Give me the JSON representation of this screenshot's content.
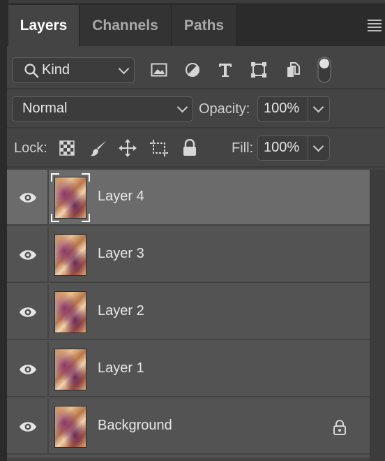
{
  "tabs": [
    {
      "label": "Layers",
      "active": true
    },
    {
      "label": "Channels",
      "active": false
    },
    {
      "label": "Paths",
      "active": false
    }
  ],
  "filter": {
    "kind_label": "Kind",
    "icons": [
      "image-filter-icon",
      "adjustment-filter-icon",
      "type-filter-icon",
      "shape-filter-icon",
      "smart-object-filter-icon",
      "filter-toggle-icon"
    ]
  },
  "blend": {
    "mode": "Normal",
    "opacity_label": "Opacity:",
    "opacity_value": "100%"
  },
  "lock_row": {
    "lock_label": "Lock:",
    "fill_label": "Fill:",
    "fill_value": "100%",
    "icons": [
      "lock-transparent-pixels-icon",
      "lock-image-pixels-icon",
      "lock-position-icon",
      "lock-artboard-icon",
      "lock-all-icon"
    ]
  },
  "layers": [
    {
      "name": "Layer 4",
      "selected": true,
      "visible": true,
      "locked": false
    },
    {
      "name": "Layer 3",
      "selected": false,
      "visible": true,
      "locked": false
    },
    {
      "name": "Layer 2",
      "selected": false,
      "visible": true,
      "locked": false
    },
    {
      "name": "Layer 1",
      "selected": false,
      "visible": true,
      "locked": false
    },
    {
      "name": "Background",
      "selected": false,
      "visible": true,
      "locked": true
    }
  ],
  "colors": {
    "panel_bg": "#444444",
    "layer_bg": "#535353",
    "layer_selected_bg": "#6b6b6b",
    "tab_active_text": "#ffffff"
  }
}
